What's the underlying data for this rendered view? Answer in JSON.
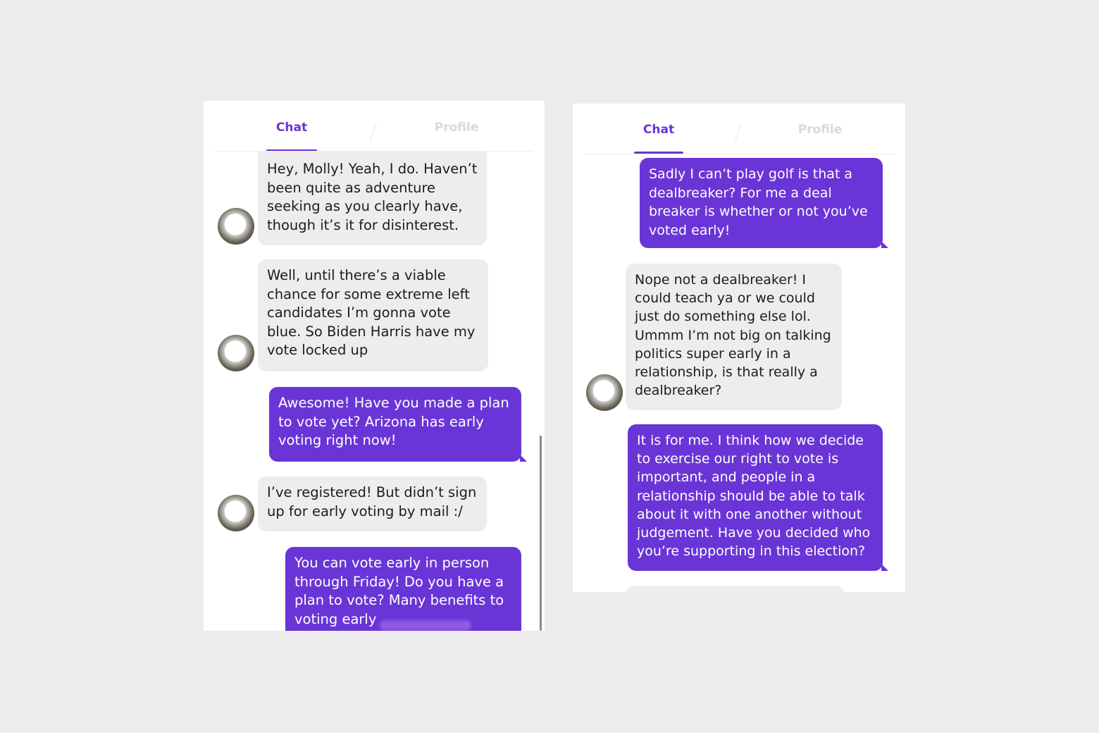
{
  "left_panel": {
    "tabs": {
      "chat": "Chat",
      "profile": "Profile"
    },
    "messages": [
      {
        "from": "match",
        "text": "Hey, Molly! Yeah, I do. Haven’t\nbeen quite as adventure\nseeking as you clearly have,\nthough it’s  it for disinterest."
      },
      {
        "from": "match",
        "text": "Well, until there’s a viable\nchance for some extreme left\ncandidates I’m gonna vote\nblue. So Biden Harris have my\nvote locked up"
      },
      {
        "from": "me",
        "text": "Awesome! Have you made a plan\nto vote yet? Arizona has early\nvoting right now!"
      },
      {
        "from": "match",
        "text": "I’ve registered! But didn’t sign\nup for early voting by mail :/"
      },
      {
        "from": "me",
        "text": "You can vote early in person\nthrough Friday! Do you have a\nplan to vote? Many benefits to\nvoting early"
      }
    ]
  },
  "right_panel": {
    "tabs": {
      "chat": "Chat",
      "profile": "Profile"
    },
    "messages": [
      {
        "from": "me",
        "text": "Sadly I can’t play golf is that a\ndealbreaker? For me a deal\nbreaker is whether or not you’ve\nvoted early!"
      },
      {
        "from": "match",
        "text": "Nope not a dealbreaker! I\ncould teach ya or we could\njust do something else lol.\nUmmm I’m not big on talking\npolitics super early in a\nrelationship, is that really a\ndealbreaker?"
      },
      {
        "from": "me",
        "text": "It is for me. I think how we decide\nto exercise our right to vote is\nimportant, and people in a\nrelationship should be able to talk\nabout it with one another without\njudgement. Have you decided who\nyou’re supporting in this election?"
      }
    ]
  },
  "colors": {
    "accent": "#6a35d6",
    "incoming_bubble": "#ededed",
    "background": "#ececec"
  }
}
